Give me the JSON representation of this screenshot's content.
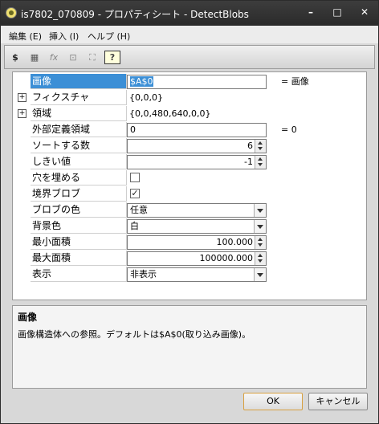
{
  "window": {
    "title": "is7802_070809 - プロパティシート - DetectBlobs",
    "min_glyph": "–",
    "max_glyph": "□",
    "close_glyph": "✕"
  },
  "menu": {
    "edit": "編集 (E)",
    "insert": "挿入 (I)",
    "help": "ヘルプ (H)"
  },
  "toolbar": {
    "fx_glyph": "fx",
    "help_glyph": "?"
  },
  "properties": {
    "image_label": "画像",
    "image_value": "$A$0",
    "image_note": "= 画像",
    "features_label": "フィクスチャ",
    "features_value": "{0,0,0}",
    "region_label": "領域",
    "region_value": "{0,0,480,640,0,0}",
    "ext_region_label": "外部定義領域",
    "ext_region_value": "0",
    "ext_region_note": "= 0",
    "sort_count_label": "ソートする数",
    "sort_count_value": "6",
    "threshold_label": "しきい値",
    "threshold_value": "-1",
    "fill_holes_label": "穴を埋める",
    "boundary_blob_label": "境界ブロブ",
    "blob_color_label": "ブロブの色",
    "blob_color_value": "任意",
    "background_label": "背景色",
    "background_value": "白",
    "min_area_label": "最小面積",
    "min_area_value": "100.000",
    "max_area_label": "最大面積",
    "max_area_value": "100000.000",
    "display_label": "表示",
    "display_value": "非表示",
    "expand_glyph": "+",
    "check_glyph": "✓"
  },
  "description": {
    "title": "画像",
    "text": "画像構造体への参照。デフォルトは$A$0(取り込み画像)。"
  },
  "buttons": {
    "ok": "OK",
    "cancel": "キャンセル"
  }
}
